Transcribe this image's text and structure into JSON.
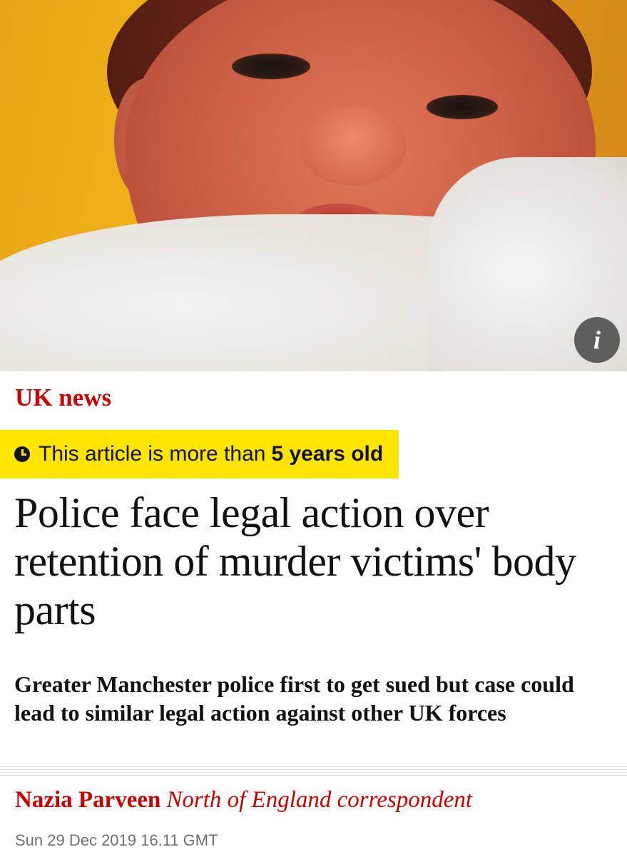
{
  "hero": {
    "image_subject": "baby-portrait",
    "info_button_label": "i"
  },
  "article": {
    "section": "UK news",
    "age_warning": {
      "icon": "clock-icon",
      "prefix": "This article is more than",
      "age": "5 years old"
    },
    "headline": "Police face legal action over retention of murder victims' body parts",
    "standfirst": "Greater Manchester police first to get sued but case could lead to similar legal action against other UK forces",
    "byline": {
      "author": "Nazia Parveen",
      "role": "North of England correspondent"
    },
    "date": "Sun 29 Dec 2019 16.11 GMT"
  },
  "colors": {
    "section_red": "#c70000",
    "warning_yellow": "#ffe500",
    "text": "#121212",
    "muted": "#707070"
  }
}
